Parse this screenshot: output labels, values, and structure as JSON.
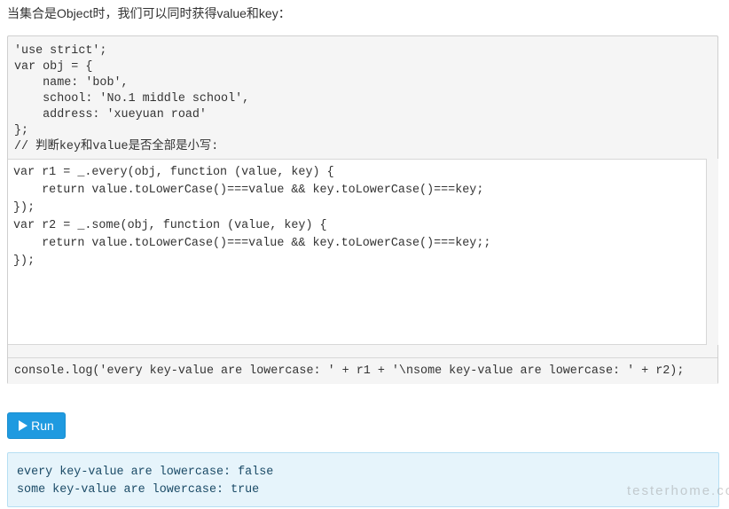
{
  "intro_text": "当集合是Object时，我们可以同时获得value和key：",
  "code": {
    "preamble": "'use strict';\nvar obj = {\n    name: 'bob',\n    school: 'No.1 middle school',\n    address: 'xueyuan road'\n};\n// 判断key和value是否全部是小写:",
    "editor_value": "var r1 = _.every(obj, function (value, key) {\n    return value.toLowerCase()===value && key.toLowerCase()===key;\n});\nvar r2 = _.some(obj, function (value, key) {\n    return value.toLowerCase()===value && key.toLowerCase()===key;;\n});",
    "console_line": "console.log('every key-value are lowercase: ' + r1 + '\\nsome key-value are lowercase: ' + r2);"
  },
  "run_button": {
    "label": "Run",
    "icon": "play-icon",
    "color": "#1f9ae0"
  },
  "output": {
    "text": "every key-value are lowercase: false\nsome key-value are lowercase: true",
    "background": "#e6f4fb"
  },
  "watermark": "testerhome.com"
}
